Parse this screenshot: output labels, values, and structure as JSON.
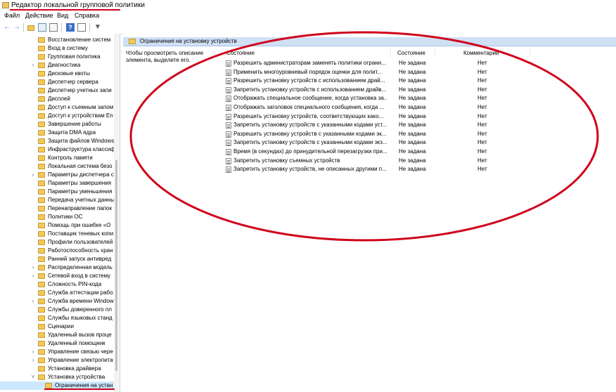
{
  "window": {
    "title": "Редактор локальной групповой политики"
  },
  "menu": [
    "Файл",
    "Действие",
    "Вид",
    "Справка"
  ],
  "toolbar": {
    "icons": [
      "back-arrow-icon",
      "forward-arrow-icon",
      "up-folder-icon",
      "show-hide-tree-icon",
      "export-list-icon",
      "help-icon",
      "properties-icon",
      "filter-icon"
    ]
  },
  "tree": {
    "items": [
      {
        "label": "Восстановление систем",
        "expander": false
      },
      {
        "label": "Вход в систему",
        "expander": false
      },
      {
        "label": "Групповая политика",
        "expander": false
      },
      {
        "label": "Диагностика",
        "expander": true
      },
      {
        "label": "Дисковые квоты",
        "expander": false
      },
      {
        "label": "Диспетчер сервера",
        "expander": false
      },
      {
        "label": "Диспетчер учетных запи",
        "expander": false
      },
      {
        "label": "Дисплей",
        "expander": false
      },
      {
        "label": "Доступ к съемным запом",
        "expander": false
      },
      {
        "label": "Доступ к устройствам En",
        "expander": false
      },
      {
        "label": "Завершение работы",
        "expander": false
      },
      {
        "label": "Защита DMA ядра",
        "expander": false
      },
      {
        "label": "Защита файлов Windows",
        "expander": false
      },
      {
        "label": "Инфраструктура классиф",
        "expander": false
      },
      {
        "label": "Контроль памяти",
        "expander": false
      },
      {
        "label": "Локальная система безо",
        "expander": false
      },
      {
        "label": "Параметры диспетчера с",
        "expander": true
      },
      {
        "label": "Параметры завершения",
        "expander": false
      },
      {
        "label": "Параметры уменьшения",
        "expander": false
      },
      {
        "label": "Передача учетных данны",
        "expander": false
      },
      {
        "label": "Перенаправление папок",
        "expander": false
      },
      {
        "label": "Политики ОС",
        "expander": false
      },
      {
        "label": "Помощь при ошибке «О",
        "expander": false
      },
      {
        "label": "Поставщик теневых копи",
        "expander": false
      },
      {
        "label": "Профили пользователей",
        "expander": false
      },
      {
        "label": "Работоспособность хран",
        "expander": false
      },
      {
        "label": "Ранний запуск антивред",
        "expander": false
      },
      {
        "label": "Распределенная модель",
        "expander": true
      },
      {
        "label": "Сетевой вход в систему",
        "expander": true
      },
      {
        "label": "Сложность PIN-кода",
        "expander": false
      },
      {
        "label": "Служба аттестации рабо",
        "expander": false
      },
      {
        "label": "Служба времени Window",
        "expander": true
      },
      {
        "label": "Службы доверенного пл",
        "expander": false
      },
      {
        "label": "Службы языковых станд",
        "expander": false
      },
      {
        "label": "Сценарии",
        "expander": false
      },
      {
        "label": "Удаленный вызов проце",
        "expander": false
      },
      {
        "label": "Удаленный помощник",
        "expander": false
      },
      {
        "label": "Управление связью чере",
        "expander": true
      },
      {
        "label": "Управление электропита",
        "expander": true
      },
      {
        "label": "Установка драйвера",
        "expander": false
      },
      {
        "label": "Установка устройства",
        "expander": "open"
      },
      {
        "label": "Ограничения на устан",
        "expander": false,
        "selected": true
      }
    ]
  },
  "pane": {
    "header": "Ограничения на установку устройств",
    "description": "Чтобы просмотреть описание элемента, выделите его.",
    "columns": {
      "name": "Состояние",
      "state": "Состояние",
      "comment": "Комментарий"
    },
    "rows": [
      {
        "name": "Разрешить администраторам заменять политики ограни...",
        "state": "Не задана",
        "comment": "Нет"
      },
      {
        "name": "Применить многоуровневый порядок оценки для полит...",
        "state": "Не задана",
        "comment": "Нет"
      },
      {
        "name": "Разрешить установку устройств с использованием драй...",
        "state": "Не задана",
        "comment": "Нет"
      },
      {
        "name": "Запретить установку устройств с использованием драйв...",
        "state": "Не задана",
        "comment": "Нет"
      },
      {
        "name": "Отображать специальное сообщение, когда установка за...",
        "state": "Не задана",
        "comment": "Нет"
      },
      {
        "name": "Отображать заголовок специального сообщения, когда ...",
        "state": "Не задана",
        "comment": "Нет"
      },
      {
        "name": "Разрешить установку устройств, соответствующих како...",
        "state": "Не задана",
        "comment": "Нет"
      },
      {
        "name": "Запретить установку устройств с указанными кодами уст...",
        "state": "Не задана",
        "comment": "Нет"
      },
      {
        "name": "Разрешить установку устройств с указанными кодами эк...",
        "state": "Не задана",
        "comment": "Нет"
      },
      {
        "name": "Запретить установку устройств с указанными кодами экз...",
        "state": "Не задана",
        "comment": "Нет"
      },
      {
        "name": "Время (в секундах) до принудительной перезагрузки при...",
        "state": "Не задана",
        "comment": "Нет"
      },
      {
        "name": "Запретить установку съемных устройств",
        "state": "Не задана",
        "comment": "Нет"
      },
      {
        "name": "Запретить установку устройств, не описанных другими п...",
        "state": "Не задана",
        "comment": "Нет"
      }
    ]
  },
  "annotations": {
    "color": "#d0021b"
  }
}
